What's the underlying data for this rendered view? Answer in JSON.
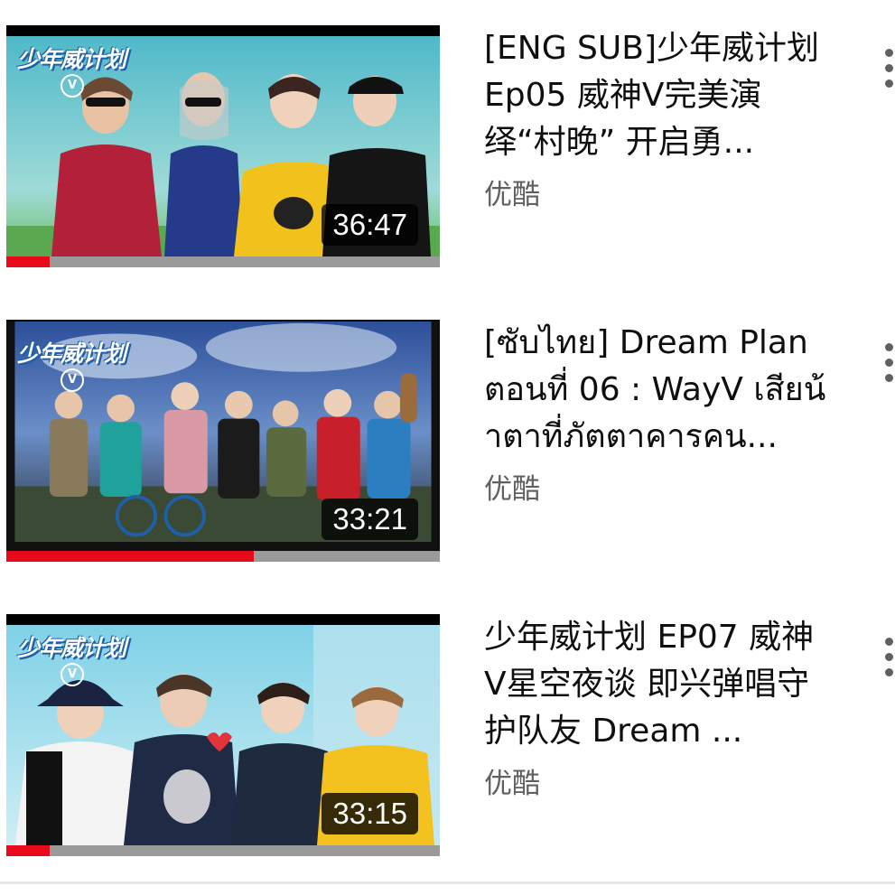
{
  "videos": [
    {
      "title": "[ENG SUB]少年威计划 Ep05 威神V完美演绎“村晚” 开启勇...",
      "channel": "优酷",
      "duration": "36:47",
      "watched_fraction": 0.1,
      "thumbnail_logo": "少年威计划",
      "thumbnail_badge": "V",
      "menu_icon": "more-vert-icon"
    },
    {
      "title": "[ซับไทย] Dream Plan ตอนที่ 06 : WayV เสียน้ำตาที่ภัตตาคารคน...",
      "channel": "优酷",
      "duration": "33:21",
      "watched_fraction": 0.57,
      "thumbnail_logo": "少年威计划",
      "thumbnail_badge": "V",
      "menu_icon": "more-vert-icon"
    },
    {
      "title": "少年威计划  EP07 威神V星空夜谈 即兴弹唱守护队友 Dream ...",
      "channel": "优酷",
      "duration": "33:15",
      "watched_fraction": 0.1,
      "thumbnail_logo": "少年威计划",
      "thumbnail_badge": "V",
      "menu_icon": "more-vert-icon"
    }
  ],
  "colors": {
    "progress_fill": "#e8091b",
    "progress_track": "#9a9a9a",
    "title_text": "#0f0f0f",
    "channel_text": "#606060"
  }
}
